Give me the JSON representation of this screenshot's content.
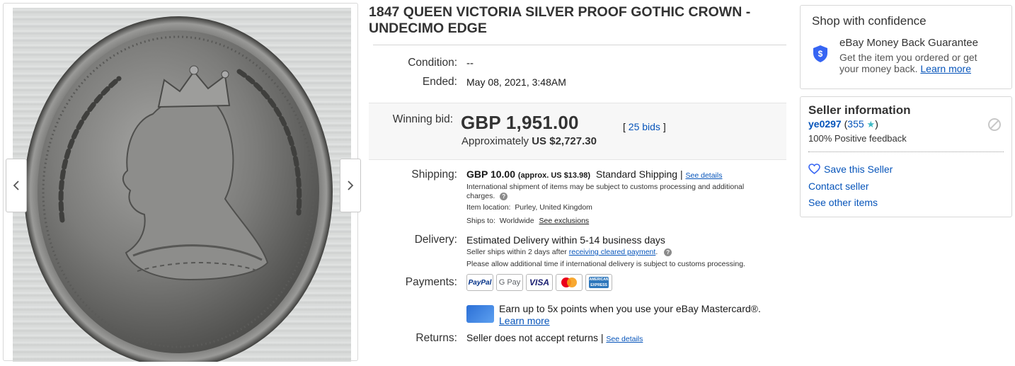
{
  "title": "1847 QUEEN VICTORIA SILVER PROOF GOTHIC CROWN - UNDECIMO EDGE",
  "gallery": {
    "prev_icon": "chevron-left-icon",
    "next_icon": "chevron-right-icon"
  },
  "details": {
    "condition_label": "Condition:",
    "condition_value": "--",
    "ended_label": "Ended:",
    "ended_value": "May 08, 2021, 3:48AM"
  },
  "bid": {
    "label": "Winning bid:",
    "price": "GBP 1,951.00",
    "approx_prefix": "Approximately",
    "approx_value": "US $2,727.30",
    "bids_open": "[",
    "bids_link": "25 bids",
    "bids_close": "]"
  },
  "shipping": {
    "label": "Shipping:",
    "cost": "GBP 10.00",
    "approx": "(approx. US $13.98)",
    "method": "Standard Shipping |",
    "details_link": "See details",
    "intl_note": "International shipment of items may be subject to customs processing and additional",
    "intl_note_2": "charges.",
    "location_label": "Item location:",
    "location_value": "Purley, United Kingdom",
    "ships_to_label": "Ships to:",
    "ships_to_value": "Worldwide",
    "exclusions_link": "See exclusions"
  },
  "delivery": {
    "label": "Delivery:",
    "estimate": "Estimated Delivery within 5-14 business days",
    "handling_prefix": "Seller ships within 2 days after",
    "handling_link": "receiving cleared payment",
    "handling_suffix": ".",
    "intl_note": "Please allow additional time if international delivery is subject to customs processing."
  },
  "payments": {
    "label": "Payments:",
    "methods": [
      "PayPal",
      "G Pay",
      "VISA",
      "Mastercard",
      "American Express"
    ]
  },
  "promo": {
    "text": "Earn up to 5x points when you use your eBay Mastercard®.",
    "link": "Learn more"
  },
  "returns": {
    "label": "Returns:",
    "text": "Seller does not accept returns |",
    "link": "See details"
  },
  "confidence": {
    "heading": "Shop with confidence",
    "guarantee_title": "eBay Money Back Guarantee",
    "guarantee_text_1": "Get the item you ordered or get",
    "guarantee_text_2": "your money back.",
    "learn_more": "Learn more",
    "icon": "shield-dollar-icon"
  },
  "seller": {
    "heading": "Seller information",
    "username": "ye0297",
    "feedback_open": "(",
    "feedback_score": "355",
    "feedback_close": ")",
    "positive": "100% Positive feedback",
    "save_link": "Save this Seller",
    "contact_link": "Contact seller",
    "other_items_link": "See other items"
  },
  "colors": {
    "link": "#0654ba",
    "star": "#3cb9c4",
    "mastercard_red": "#eb001b",
    "mastercard_yellow": "#f79e1b",
    "paypal_blue": "#003087",
    "visa_blue": "#1a1f71",
    "amex_blue": "#2e77bc"
  }
}
